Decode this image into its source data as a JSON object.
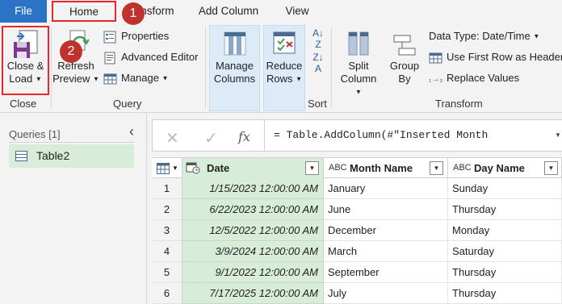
{
  "tabs": {
    "file": "File",
    "home": "Home",
    "transform": "Transform",
    "add_column": "Add Column",
    "view": "View"
  },
  "badges": {
    "b1": "1",
    "b2": "2"
  },
  "ribbon": {
    "close_load_line1": "Close &",
    "close_load_line2": "Load",
    "refresh_line1": "Refresh",
    "refresh_line2": "Preview",
    "properties": "Properties",
    "advanced_editor": "Advanced Editor",
    "manage": "Manage",
    "manage_columns_line1": "Manage",
    "manage_columns_line2": "Columns",
    "reduce_rows_line1": "Reduce",
    "reduce_rows_line2": "Rows",
    "split_column_line1": "Split",
    "split_column_line2": "Column",
    "group_by_line1": "Group",
    "group_by_line2": "By",
    "data_type": "Data Type: Date/Time",
    "use_first_row": "Use First Row as Headers",
    "replace_values": "Replace Values",
    "group_close": "Close",
    "group_query": "Query",
    "group_sort": "Sort",
    "group_transform": "Transform"
  },
  "queries": {
    "label": "Queries [1]",
    "items": [
      "Table2"
    ]
  },
  "formula": {
    "cancel_glyph": "✕",
    "check_glyph": "✓",
    "fx_glyph": "fx",
    "text": "= Table.AddColumn(#\"Inserted Month"
  },
  "table": {
    "columns": [
      {
        "type": "",
        "name": "Date"
      },
      {
        "type": "ABC",
        "name": "Month Name"
      },
      {
        "type": "ABC",
        "name": "Day Name"
      }
    ],
    "rows": [
      {
        "n": "1",
        "date": "1/15/2023 12:00:00 AM",
        "month": "January",
        "day": "Sunday"
      },
      {
        "n": "2",
        "date": "6/22/2023 12:00:00 AM",
        "month": "June",
        "day": "Thursday"
      },
      {
        "n": "3",
        "date": "12/5/2022 12:00:00 AM",
        "month": "December",
        "day": "Monday"
      },
      {
        "n": "4",
        "date": "3/9/2024 12:00:00 AM",
        "month": "March",
        "day": "Saturday"
      },
      {
        "n": "5",
        "date": "9/1/2022 12:00:00 AM",
        "month": "September",
        "day": "Thursday"
      },
      {
        "n": "6",
        "date": "7/17/2025 12:00:00 AM",
        "month": "July",
        "day": "Thursday"
      }
    ]
  },
  "colors": {
    "file_tab": "#2b73c4",
    "highlight_border": "#e8262c",
    "badge": "#c0322e",
    "selected_column": "#d7ecd9"
  }
}
